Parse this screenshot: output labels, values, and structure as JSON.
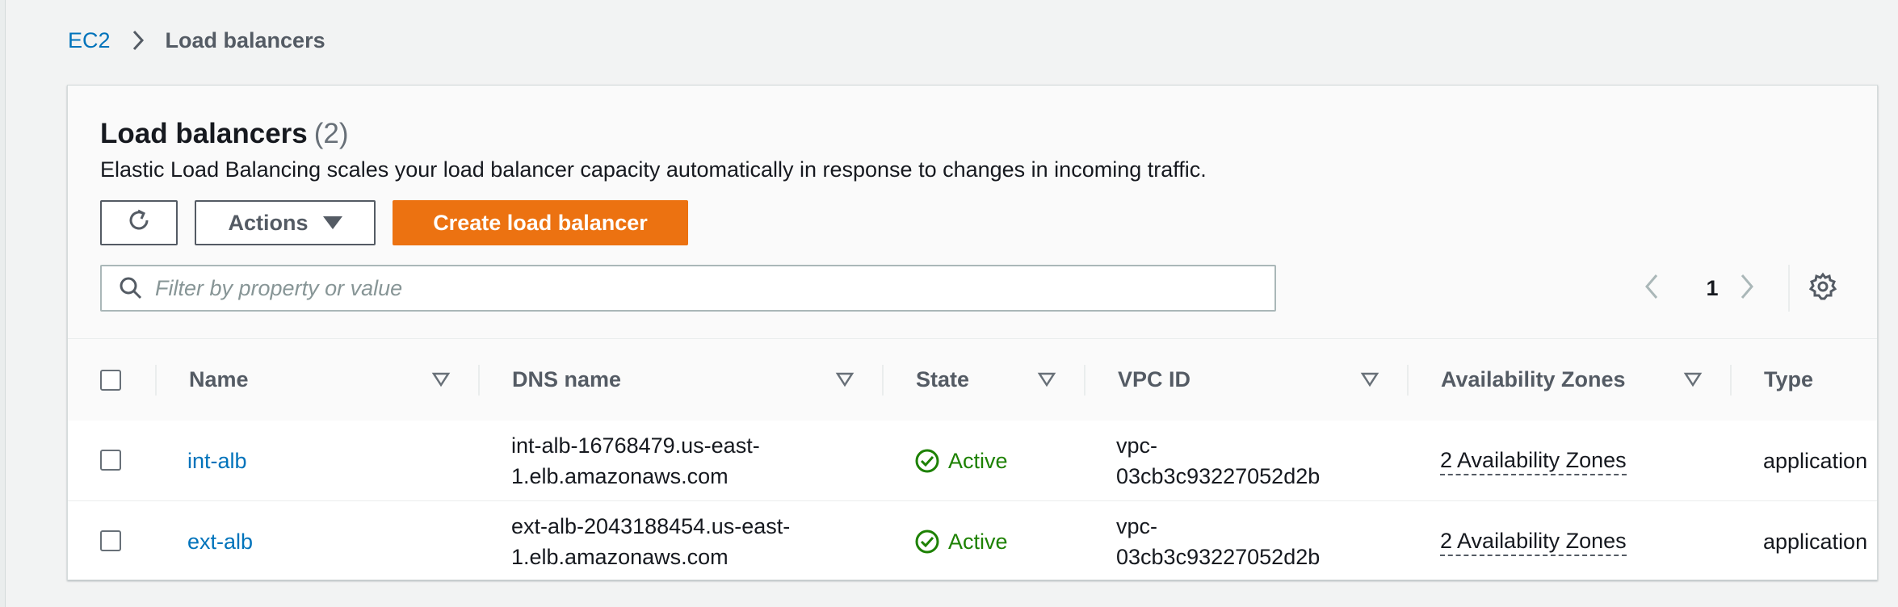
{
  "breadcrumb": {
    "root": "EC2",
    "current": "Load balancers"
  },
  "panel": {
    "title": "Load balancers",
    "count": "(2)",
    "description": "Elastic Load Balancing scales your load balancer capacity automatically in response to changes in incoming traffic."
  },
  "toolbar": {
    "refresh_icon": "refresh-icon",
    "actions_label": "Actions",
    "create_label": "Create load balancer"
  },
  "search": {
    "placeholder": "Filter by property or value",
    "value": ""
  },
  "pagination": {
    "current_page": "1"
  },
  "table": {
    "columns": [
      "Name",
      "DNS name",
      "State",
      "VPC ID",
      "Availability Zones",
      "Type"
    ],
    "rows": [
      {
        "name": "int-alb",
        "dns_line1": "int-alb-16768479.us-east-",
        "dns_line2": "1.elb.amazonaws.com",
        "state": "Active",
        "vpc_line1": "vpc-",
        "vpc_line2": "03cb3c93227052d2b",
        "az": "2 Availability Zones",
        "type": "application"
      },
      {
        "name": "ext-alb",
        "dns_line1": "ext-alb-2043188454.us-east-",
        "dns_line2": "1.elb.amazonaws.com",
        "state": "Active",
        "vpc_line1": "vpc-",
        "vpc_line2": "03cb3c93227052d2b",
        "az": "2 Availability Zones",
        "type": "application"
      }
    ]
  },
  "colors": {
    "link": "#0073bb",
    "primary_button": "#ec7211",
    "active_state": "#1d8102",
    "background": "#f2f3f3"
  }
}
